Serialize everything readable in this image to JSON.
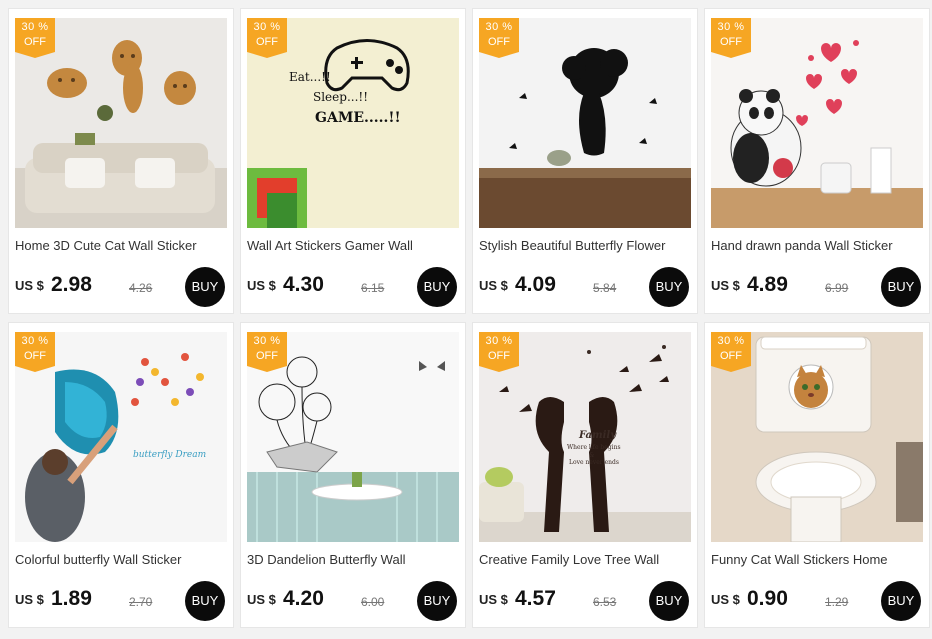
{
  "products": [
    {
      "title": "Home 3D Cute Cat Wall Sticker",
      "currency": "US $",
      "price": "2.98",
      "old_price": "4.26",
      "discount": "30 %",
      "off": "OFF",
      "buy": "BUY"
    },
    {
      "title": "Wall Art Stickers Gamer Wall",
      "currency": "US $",
      "price": "4.30",
      "old_price": "6.15",
      "discount": "30 %",
      "off": "OFF",
      "buy": "BUY"
    },
    {
      "title": "Stylish Beautiful Butterfly Flower",
      "currency": "US $",
      "price": "4.09",
      "old_price": "5.84",
      "discount": "30 %",
      "off": "OFF",
      "buy": "BUY"
    },
    {
      "title": "Hand drawn panda Wall Sticker",
      "currency": "US $",
      "price": "4.89",
      "old_price": "6.99",
      "discount": "30 %",
      "off": "OFF",
      "buy": "BUY"
    },
    {
      "title": "Colorful butterfly Wall Sticker",
      "currency": "US $",
      "price": "1.89",
      "old_price": "2.70",
      "discount": "30 %",
      "off": "OFF",
      "buy": "BUY"
    },
    {
      "title": "3D Dandelion Butterfly Wall",
      "currency": "US $",
      "price": "4.20",
      "old_price": "6.00",
      "discount": "30 %",
      "off": "OFF",
      "buy": "BUY"
    },
    {
      "title": "Creative Family Love Tree Wall",
      "currency": "US $",
      "price": "4.57",
      "old_price": "6.53",
      "discount": "30 %",
      "off": "OFF",
      "buy": "BUY"
    },
    {
      "title": "Funny Cat Wall Stickers Home",
      "currency": "US $",
      "price": "0.90",
      "old_price": "1.29",
      "discount": "30 %",
      "off": "OFF",
      "buy": "BUY"
    }
  ],
  "image_text": {
    "gamer": [
      "Eat...!!",
      "Sleep...!!",
      "GAME.....!!"
    ],
    "family": [
      "Family",
      "Where life begins",
      "&",
      "Love never ends"
    ],
    "butterfly_dream": "butterfly Dream"
  },
  "colors": {
    "badge": "#f6a623",
    "buy": "#0b0b0b",
    "page_bg": "#f2f2f2"
  }
}
